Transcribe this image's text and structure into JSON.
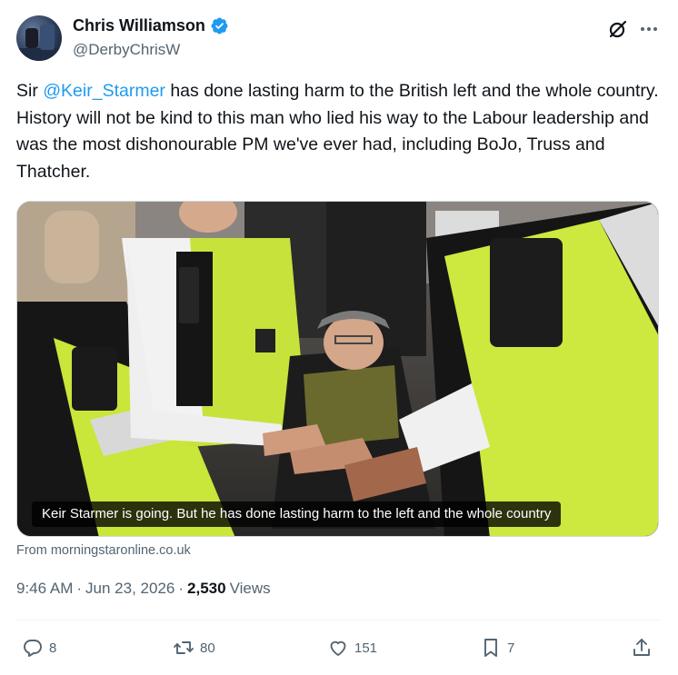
{
  "author": {
    "display_name": "Chris Williamson",
    "handle": "@DerbyChrisW",
    "verified": true
  },
  "tweet": {
    "text_before": "Sir ",
    "mention": "@Keir_Starmer",
    "text_after": " has done lasting harm to the British left and the whole country. History will not be kind to this man who lied his way to the Labour leadership and was the most dishonourable PM we've ever had, including BoJo, Truss and Thatcher."
  },
  "card": {
    "caption": "Keir Starmer is going. But he has done lasting harm to the left and the whole country",
    "source": "From morningstaronline.co.uk"
  },
  "meta": {
    "time": "9:46 AM",
    "date": "Jun 23, 2026",
    "views_count": "2,530",
    "views_label": "Views"
  },
  "actions": {
    "replies": "8",
    "reposts": "80",
    "likes": "151",
    "bookmarks": "7"
  },
  "colors": {
    "link": "#1d9bf0",
    "verified": "#1d9bf0",
    "secondary_text": "#536471",
    "primary_text": "#0f1419"
  }
}
